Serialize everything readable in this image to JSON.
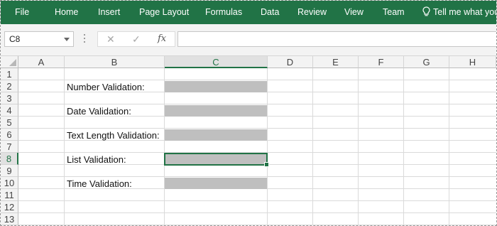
{
  "ribbon": {
    "tabs": [
      "File",
      "Home",
      "Insert",
      "Page Layout",
      "Formulas",
      "Data",
      "Review",
      "View",
      "Team"
    ],
    "tell_me": "Tell me what you",
    "accent_color": "#217346"
  },
  "formula_bar": {
    "name_box": "C8",
    "cancel_icon": "✕",
    "enter_icon": "✓",
    "fx_label": "fx",
    "formula": ""
  },
  "sheet": {
    "columns": [
      "A",
      "B",
      "C",
      "D",
      "E",
      "F",
      "G",
      "H"
    ],
    "rows": [
      "1",
      "2",
      "3",
      "4",
      "5",
      "6",
      "7",
      "8",
      "9",
      "10",
      "11",
      "12",
      "13"
    ],
    "selected_cell": "C8",
    "cell_fill_color": "#BFBFBF",
    "labels": {
      "number": "Number Validation:",
      "date": "Date Validation:",
      "text_length": "Text Length Validation:",
      "list": "List Validation:",
      "time": "Time Validation:"
    }
  }
}
